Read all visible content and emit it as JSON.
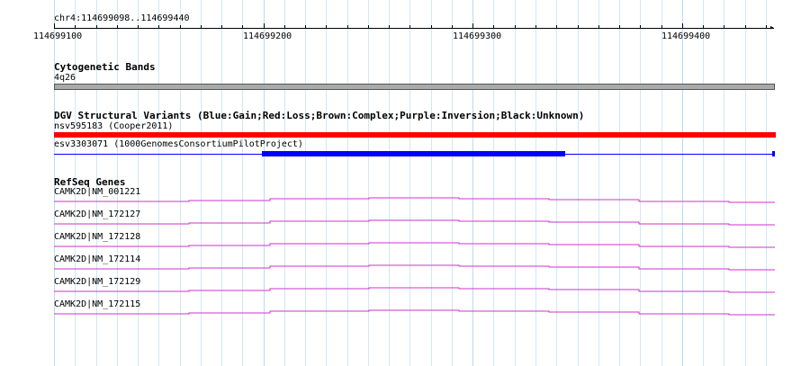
{
  "ruler": {
    "location": "chr4:114699098..114699440",
    "ticks": [
      "114699100",
      "114699200",
      "114699300",
      "114699400"
    ]
  },
  "tracks": {
    "cytoband": {
      "title": "Cytogenetic Bands",
      "band_label": "4q26",
      "band_color": "#aaaaaa"
    },
    "dgv": {
      "title": "DGV Structural Variants (Blue:Gain;Red:Loss;Brown:Complex;Purple:Inversion;Black:Unknown)",
      "variants": [
        {
          "label": "nsv595183 (Cooper2011)",
          "color": "#ff0000"
        },
        {
          "label": "esv3303071 (1000GenomesConsortiumPilotProject)",
          "color": "#0000ff"
        }
      ]
    },
    "refseq": {
      "title": "RefSeq Genes",
      "color": "#cc33cc",
      "genes": [
        {
          "label": "CAMK2D|NM_001221"
        },
        {
          "label": "CAMK2D|NM_172127"
        },
        {
          "label": "CAMK2D|NM_172128"
        },
        {
          "label": "CAMK2D|NM_172114"
        },
        {
          "label": "CAMK2D|NM_172129"
        },
        {
          "label": "CAMK2D|NM_172115"
        }
      ]
    }
  }
}
